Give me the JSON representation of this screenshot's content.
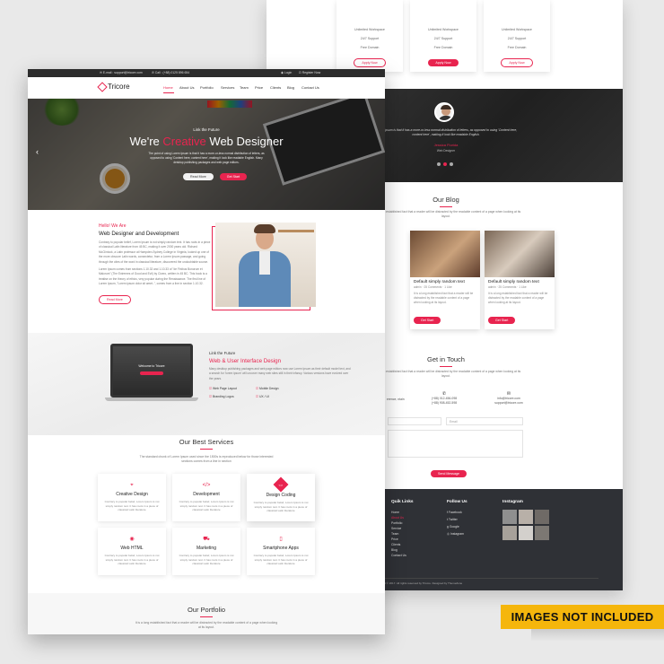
{
  "back": {
    "pricing": [
      {
        "lines": [
          "Unlimited Workspace",
          "24/7 Support",
          "Free Domain"
        ],
        "button": "Apply Now",
        "style": "outline"
      },
      {
        "lines": [
          "Unlimited Workspace",
          "24/7 Support",
          "Free Domain"
        ],
        "button": "Apply Now",
        "style": "filled"
      },
      {
        "lines": [
          "Unlimited Workspace",
          "24/7 Support",
          "Free Domain"
        ],
        "button": "Apply Now",
        "style": "outline"
      }
    ],
    "testimonial": {
      "quote": "Lorem Ipsum is that it has a more-or-less normal distribution of letters, as opposed to using 'Content here, content here', making it look like readable English.",
      "name": "Jessica Florida",
      "role": "Web Designer"
    },
    "blog": {
      "title": "Our Blog",
      "subtitle": "It is a long established fact that a reader will be distracted by the readable content of a page when looking at its layout.",
      "partial_title": "ext",
      "cards": [
        {
          "title": "Default simply random text",
          "meta": "admin  ·  25 Comments  ·  1 Like",
          "excerpt": "It is a long established fact that a reader will be distracted by the readable content of a page when looking at its layout.",
          "button": "Get Start"
        },
        {
          "title": "Default simply random text",
          "meta": "admin  ·  25 Comments  ·  1 Like",
          "excerpt": "It is a long established fact that a reader will be distracted by the readable content of a page when looking at its layout.",
          "button": "Get Start"
        }
      ]
    },
    "contact": {
      "title": "Get in Touch",
      "subtitle": "It is a long established fact that a reader will be distracted by the readable content of a page when looking at its layout.",
      "left_partial": "erence, ntain",
      "phone": [
        "(+88) 012-456-098",
        "(+88) 908-452-598"
      ],
      "email": [
        "info@tricore.com",
        "support@tricore.com"
      ],
      "email_placeholder": "Email",
      "button": "Send Message"
    },
    "footer": {
      "links_title": "Quik Links",
      "links": [
        "Home",
        "About Us",
        "Portfolio",
        "Service",
        "Team",
        "Price",
        "Clients",
        "Blog",
        "Contact Us"
      ],
      "follow_title": "Follow Us",
      "follow": [
        "Facebook",
        "Twitter",
        "Google",
        "Instagram"
      ],
      "instagram_title": "Instagram",
      "copyright": "Copyright © 2017. All rights reserved by Tricore. Designed by ThemeZone"
    }
  },
  "front": {
    "topbar": {
      "email": "E-mail : support@tricore.com",
      "call": "Call : (+88) 0125 896 654",
      "login": "Login",
      "register": "Register Now"
    },
    "brand": "Tricore",
    "nav": [
      "Home",
      "About Us",
      "Portfolio",
      "Services",
      "Team",
      "Price",
      "Clients",
      "Blog",
      "Contact Us"
    ],
    "hero": {
      "kicker": "Link the Future",
      "title_pre": "We're ",
      "title_accent": "Creative",
      "title_post": " Web Designer",
      "text": "The point of using Lorem Ipsum is that it has a more-or-less normal distribution of letters, as opposed to using 'Content here, content here', making it look like readable English. Many desktop publishing packages and web page editors.",
      "btn_more": "Read More",
      "btn_start": "Get Start"
    },
    "about": {
      "kicker": "Hello! We Are",
      "title": "Web Designer and Development",
      "p1": "Contrary to popular belief, Lorem Ipsum is not simply random text. It has roots in a piece of classical Latin literature from 45 BC, making it over 2000 years old. Richard McClintock, a Latin professor at Hampden-Sydney College in Virginia, looked up one of the more obscure Latin words, consectetur, from a Lorem Ipsum passage, and going through the cites of the word in classical literature, discovered the undoubtable source.",
      "p2": "Lorem Ipsum comes from sections 1.10.32 and 1.10.33 of \"de Finibus Bonorum et Malorum\" (The Extremes of Good and Evil) by Cicero, written in 45 BC. This book is a treatise on the theory of ethics, very popular during the Renaissance. The first line of Lorem Ipsum, \"Lorem ipsum dolor sit amet..\", comes from a line in section 1.10.32.",
      "button": "Read More"
    },
    "ui": {
      "kicker": "Link the Future",
      "title": "Web & User Interface Design",
      "text": "Many desktop publishing packages and web page editors now use Lorem Ipsum as their default model text, and a search for 'lorem ipsum' will uncover many web sites still in their infancy. Various versions have evolved over the years.",
      "features": [
        "Web Page Layout",
        "Mobile Design",
        "Branding Logos",
        "UX / UI"
      ],
      "laptop_text": "Welcome to Tricore"
    },
    "services": {
      "title": "Our Best Services",
      "subtitle": "The standard chunk of Lorem Ipsum used since the 1500s is reproduced below for those interested sections comes from a line in section",
      "items": [
        {
          "name": "Creative Design",
          "icon": "⌖",
          "desc": "Contrary to popular belief, Lorem Ipsum is not simply random text. It has roots in a piece of classical Latin literature"
        },
        {
          "name": "Development",
          "icon": "</>",
          "desc": "Contrary to popular belief, Lorem Ipsum is not simply random text. It has roots in a piece of classical Latin literature"
        },
        {
          "name": "Design Coding",
          "icon": "<>",
          "desc": "Contrary to popular belief, Lorem Ipsum is not simply random text. It has roots in a piece of classical Latin literature"
        },
        {
          "name": "Web HTML",
          "icon": "◉",
          "desc": "Contrary to popular belief, Lorem Ipsum is not simply random text. It has roots in a piece of classical Latin literature"
        },
        {
          "name": "Marketing",
          "icon": "⛟",
          "desc": "Contrary to popular belief, Lorem Ipsum is not simply random text. It has roots in a piece of classical Latin literature"
        },
        {
          "name": "Smartphone Apps",
          "icon": "▯",
          "desc": "Contrary to popular belief, Lorem Ipsum is not simply random text. It has roots in a piece of classical Latin literature"
        }
      ]
    },
    "portfolio": {
      "title": "Our Portfolio",
      "subtitle": "It is a long established fact that a reader will be distracted by the readable content of a page when looking at its layout."
    }
  },
  "badge": "IMAGES NOT INCLUDED",
  "colors": {
    "accent": "#e8244f",
    "dark": "#2c2c2c",
    "badge": "#f5b60c"
  }
}
